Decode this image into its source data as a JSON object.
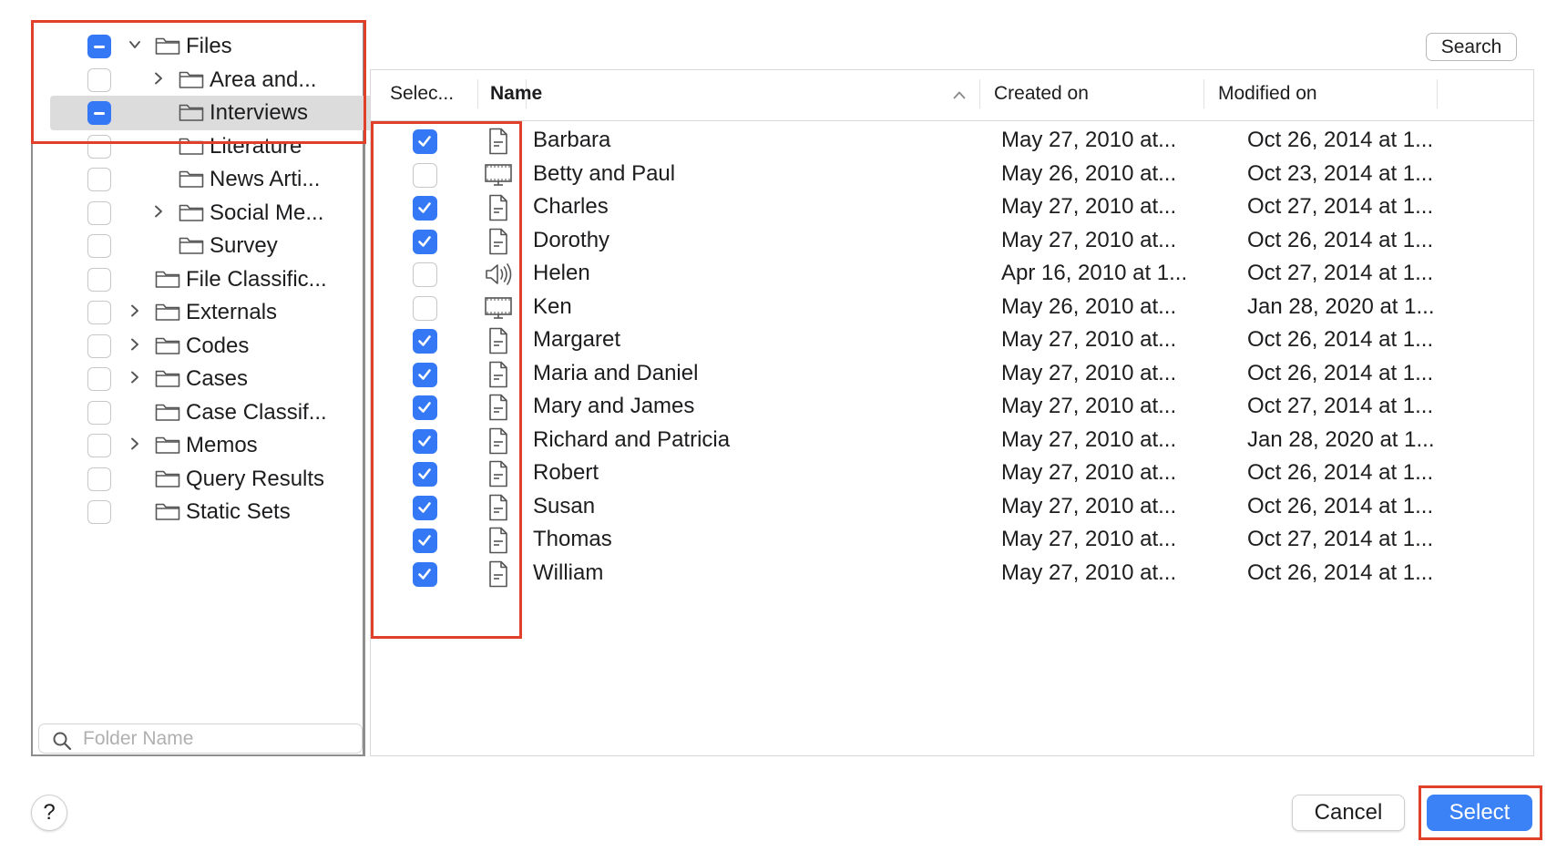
{
  "tree": {
    "items": [
      {
        "label": "Files",
        "check": "mixed",
        "expander": "open",
        "level": 0,
        "selected": false
      },
      {
        "label": "Area and...",
        "check": "none",
        "expander": "closed",
        "level": 1,
        "selected": false
      },
      {
        "label": "Interviews",
        "check": "mixed",
        "expander": "none",
        "level": 1,
        "selected": true
      },
      {
        "label": "Literature",
        "check": "none",
        "expander": "none",
        "level": 1,
        "selected": false
      },
      {
        "label": "News Arti...",
        "check": "none",
        "expander": "none",
        "level": 1,
        "selected": false
      },
      {
        "label": "Social Me...",
        "check": "none",
        "expander": "closed",
        "level": 1,
        "selected": false
      },
      {
        "label": "Survey",
        "check": "none",
        "expander": "none",
        "level": 1,
        "selected": false
      },
      {
        "label": "File Classific...",
        "check": "none",
        "expander": "none",
        "level": 0,
        "selected": false
      },
      {
        "label": "Externals",
        "check": "none",
        "expander": "closed",
        "level": 0,
        "selected": false
      },
      {
        "label": "Codes",
        "check": "none",
        "expander": "closed",
        "level": 0,
        "selected": false
      },
      {
        "label": "Cases",
        "check": "none",
        "expander": "closed",
        "level": 0,
        "selected": false
      },
      {
        "label": "Case Classif...",
        "check": "none",
        "expander": "none",
        "level": 0,
        "selected": false
      },
      {
        "label": "Memos",
        "check": "none",
        "expander": "closed",
        "level": 0,
        "selected": false
      },
      {
        "label": "Query Results",
        "check": "none",
        "expander": "none",
        "level": 0,
        "selected": false
      },
      {
        "label": "Static Sets",
        "check": "none",
        "expander": "none",
        "level": 0,
        "selected": false
      }
    ],
    "search_placeholder": "Folder Name"
  },
  "search_button_label": "Search",
  "table": {
    "columns": {
      "select": "Selec...",
      "name": "Name",
      "created": "Created on",
      "modified": "Modified on"
    },
    "sort": {
      "column": "name",
      "direction": "ascending",
      "icon": "chevron-up-icon"
    },
    "rows": [
      {
        "checked": true,
        "type": "document",
        "name": "Barbara",
        "created": "May 27, 2010 at...",
        "modified": "Oct 26, 2014 at 1..."
      },
      {
        "checked": false,
        "type": "video",
        "name": "Betty and Paul",
        "created": "May 26, 2010 at...",
        "modified": "Oct 23, 2014 at 1..."
      },
      {
        "checked": true,
        "type": "document",
        "name": "Charles",
        "created": "May 27, 2010 at...",
        "modified": "Oct 27, 2014 at 1..."
      },
      {
        "checked": true,
        "type": "document",
        "name": "Dorothy",
        "created": "May 27, 2010 at...",
        "modified": "Oct 26, 2014 at 1..."
      },
      {
        "checked": false,
        "type": "audio",
        "name": "Helen",
        "created": "Apr 16, 2010 at 1...",
        "modified": "Oct 27, 2014 at 1..."
      },
      {
        "checked": false,
        "type": "video",
        "name": "Ken",
        "created": "May 26, 2010 at...",
        "modified": "Jan 28, 2020 at 1..."
      },
      {
        "checked": true,
        "type": "document",
        "name": "Margaret",
        "created": "May 27, 2010 at...",
        "modified": "Oct 26, 2014 at 1..."
      },
      {
        "checked": true,
        "type": "document",
        "name": "Maria and Daniel",
        "created": "May 27, 2010 at...",
        "modified": "Oct 26, 2014 at 1..."
      },
      {
        "checked": true,
        "type": "document",
        "name": "Mary and James",
        "created": "May 27, 2010 at...",
        "modified": "Oct 27, 2014 at 1..."
      },
      {
        "checked": true,
        "type": "document",
        "name": "Richard and Patricia",
        "created": "May 27, 2010 at...",
        "modified": "Jan 28, 2020 at 1..."
      },
      {
        "checked": true,
        "type": "document",
        "name": "Robert",
        "created": "May 27, 2010 at...",
        "modified": "Oct 26, 2014 at 1..."
      },
      {
        "checked": true,
        "type": "document",
        "name": "Susan",
        "created": "May 27, 2010 at...",
        "modified": "Oct 26, 2014 at 1..."
      },
      {
        "checked": true,
        "type": "document",
        "name": "Thomas",
        "created": "May 27, 2010 at...",
        "modified": "Oct 27, 2014 at 1..."
      },
      {
        "checked": true,
        "type": "document",
        "name": "William",
        "created": "May 27, 2010 at...",
        "modified": "Oct 26, 2014 at 1..."
      }
    ]
  },
  "footer": {
    "help_label": "?",
    "cancel_label": "Cancel",
    "select_label": "Select"
  },
  "colors": {
    "accent": "#3478f6",
    "annotation": "#e0402a",
    "selection": "#dcdcdc"
  }
}
